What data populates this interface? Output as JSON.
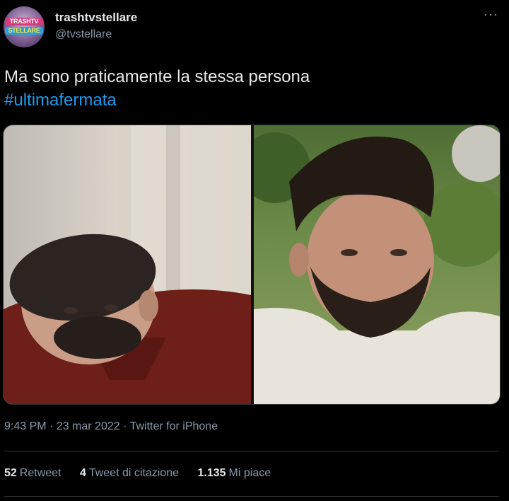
{
  "author": {
    "display_name": "trashtvstellare",
    "handle": "@tvstellare",
    "avatar_text_line1": "TRASHTV",
    "avatar_text_line2": "STELLARE"
  },
  "menu_icon": "more-horizontal-icon",
  "menu_glyph": "···",
  "tweet": {
    "text": "Ma sono praticamente la stessa persona",
    "hashtag": "#ultimafermata"
  },
  "media": {
    "photos": [
      "photo-left",
      "photo-right"
    ]
  },
  "meta": {
    "time": "9:43 PM",
    "dot1": " · ",
    "date": "23 mar 2022",
    "dot2": " · ",
    "source": "Twitter for iPhone"
  },
  "stats": {
    "retweets_count": "52",
    "retweets_label": "Retweet",
    "quotes_count": "4",
    "quotes_label": "Tweet di citazione",
    "likes_count": "1.135",
    "likes_label": "Mi piace"
  },
  "colors": {
    "background": "#000000",
    "text": "#e7e9ea",
    "secondary": "#8b98a5",
    "link": "#1d9bf0"
  }
}
